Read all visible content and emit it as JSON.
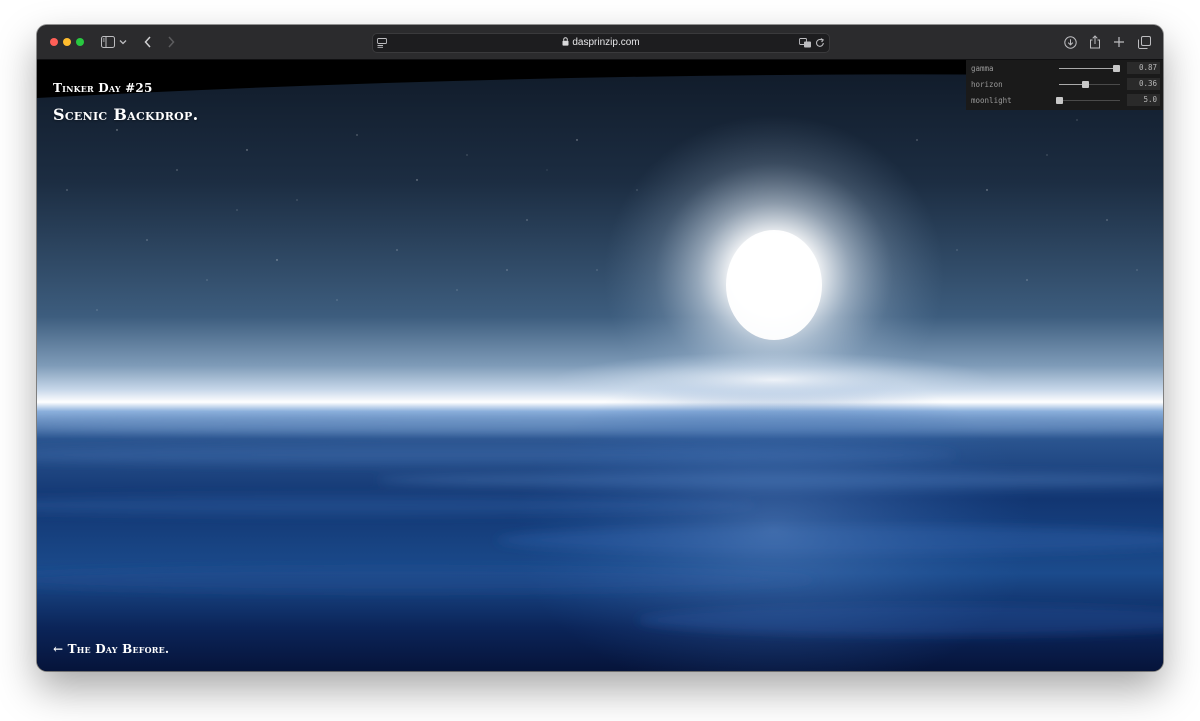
{
  "browser": {
    "url": "dasprinzip.com"
  },
  "page": {
    "subtitle": "Tinker Day #25",
    "title": "Scenic Backdrop.",
    "back_link": "← The Day Before."
  },
  "controls": [
    {
      "label": "gamma",
      "value": "0.87",
      "fraction": 0.93
    },
    {
      "label": "horizon",
      "value": "0.36",
      "fraction": 0.43
    },
    {
      "label": "moonlight",
      "value": "5.0",
      "fraction": 0.0
    }
  ],
  "colors": {
    "sky_top": "#141e2c",
    "sky_mid": "#3c5f80",
    "horizon_glow": "#dde8f5",
    "sea": "#1f4a8a",
    "sea_deep": "#06143a",
    "moon": "#ffffff"
  }
}
